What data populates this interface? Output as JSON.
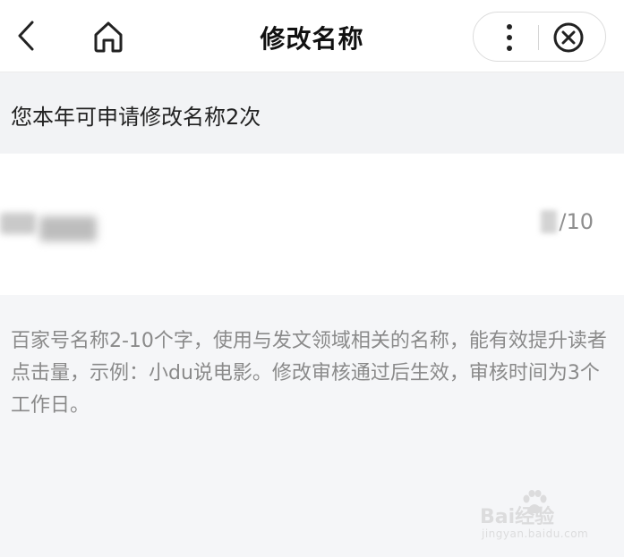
{
  "nav": {
    "title": "修改名称",
    "back_icon": "chevron-left-icon",
    "home_icon": "home-icon",
    "more_icon": "more-vertical-icon",
    "close_icon": "close-circle-icon"
  },
  "notice": {
    "text": "您本年可申请修改名称2次"
  },
  "name_field": {
    "value": "",
    "counter_max": "/10"
  },
  "hint": {
    "text": "百家号名称2-10个字，使用与发文领域相关的名称，能有效提升读者点击量，示例：小du说电影。修改审核通过后生效，审核时间为3个工作日。"
  },
  "watermark": {
    "brand": "Bai经验",
    "url": "jingyan.baidu.com"
  },
  "colors": {
    "page_bg": "#f5f6f8",
    "card_bg": "#ffffff",
    "hint_text": "#8a8a8a",
    "counter_text": "#8e8e8e"
  }
}
